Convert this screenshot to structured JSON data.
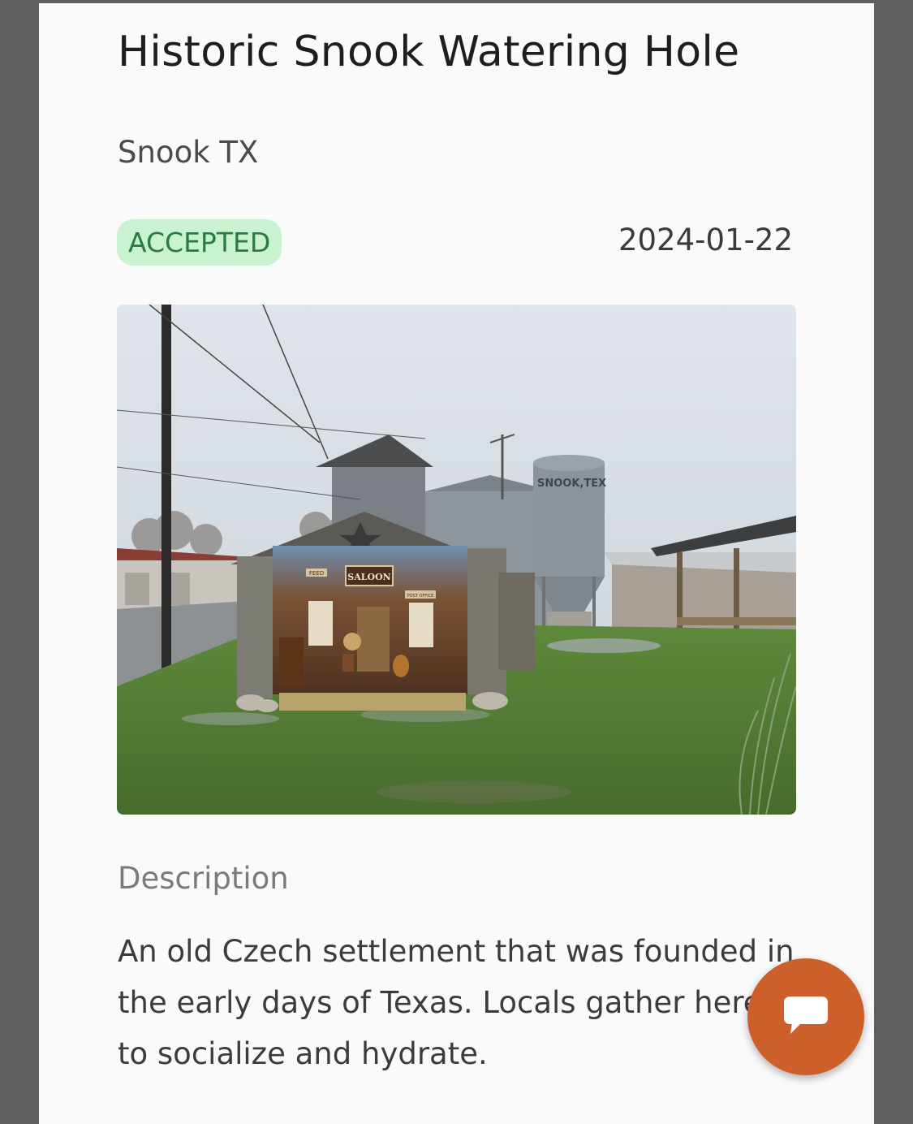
{
  "listing": {
    "title": "Historic Snook Watering Hole",
    "location": "Snook TX",
    "status": "ACCEPTED",
    "date": "2024-01-22",
    "photo_alt": "Weathered wooden shed with a saloon mural, grain silo and tin-roofed buildings on a rainy day",
    "photo_text": {
      "saloon_sign": "SALOON",
      "feed_sign": "FEED",
      "post_office_sign": "POST OFFICE",
      "silo_lettering": "SNOOK,TEX"
    }
  },
  "description": {
    "label": "Description",
    "text": "An old Czech settlement that was founded in the early days of Texas. Locals gather here to socialize and hydrate."
  },
  "chat": {
    "icon": "chat-bubble-icon"
  },
  "colors": {
    "badge_bg": "#c8f2d0",
    "badge_text": "#2b7a3f",
    "chat_button": "#cc5f2a"
  }
}
